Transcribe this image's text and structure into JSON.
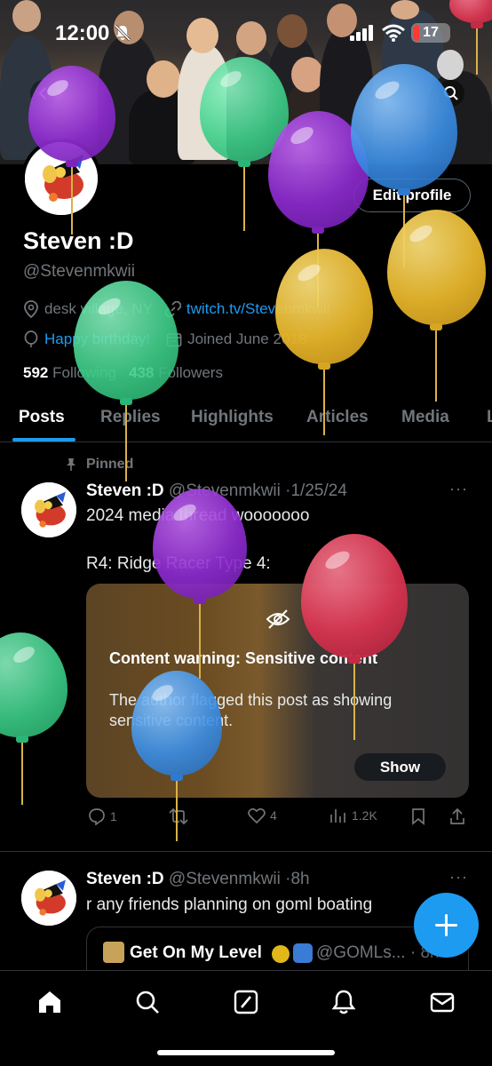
{
  "status_bar": {
    "time": "12:00",
    "battery": "17"
  },
  "profile": {
    "name": "Steven :D",
    "handle": "@Stevenmkwii",
    "location": "desk village, NY",
    "website": "twitch.tv/Stevenmkwii",
    "birthday": "Happy birthday!",
    "joined": "Joined June 2018",
    "following_count": "592",
    "following_label": "Following",
    "followers_count": "438",
    "followers_label": "Followers",
    "edit_button": "Edit profile"
  },
  "tabs": [
    "Posts",
    "Replies",
    "Highlights",
    "Articles",
    "Media",
    "L"
  ],
  "pinned_post": {
    "pinned_label": "Pinned",
    "author": "Steven :D",
    "handle": "@Stevenmkwii",
    "date": "1/25/24",
    "text_line1": "2024 media thread wooooooo",
    "text_line2": "R4: Ridge Racer Type 4:",
    "content_warning": {
      "title": "Content warning: Sensitive content",
      "body": "The author flagged this post as showing sensitive content.",
      "show_button": "Show"
    },
    "replies": "1",
    "retweets": "",
    "likes": "4",
    "views": "1.2K"
  },
  "second_post": {
    "author": "Steven :D",
    "handle": "@Stevenmkwii",
    "time": "8h",
    "text": "r any friends planning on goml boating",
    "quote": {
      "name": "Get On My Level",
      "handle": "@GOMLs...",
      "time": "8h"
    }
  },
  "colors": {
    "accent": "#1d9bf0",
    "balloon_purple": "#8e2bd0",
    "balloon_green": "#3ecf8a",
    "balloon_blue": "#3a8ee6",
    "balloon_yellow": "#e6b52a",
    "balloon_red": "#d8344f"
  },
  "icons": {
    "nav": [
      "home-icon",
      "search-icon",
      "grok-icon",
      "bell-icon",
      "mail-icon"
    ]
  }
}
